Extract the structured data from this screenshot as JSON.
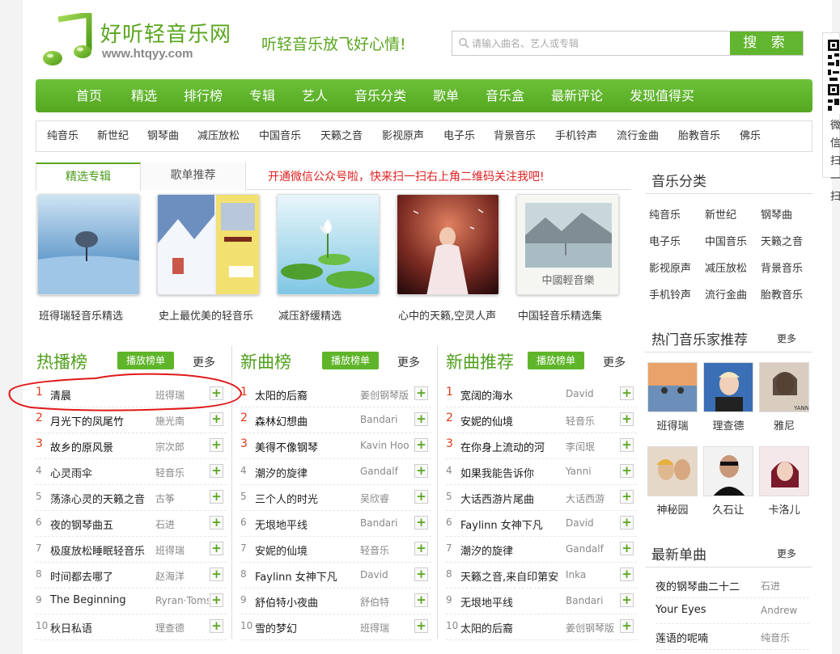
{
  "header": {
    "site_name": "好听轻音乐网",
    "site_url": "www.htqyy.com",
    "slogan": "听轻音乐放飞好心情!",
    "search_placeholder": "请输入曲名、艺人或专辑",
    "search_button": "搜 索",
    "qr_text": "微信扫一扫"
  },
  "nav": [
    "首页",
    "精选",
    "排行榜",
    "专辑",
    "艺人",
    "音乐分类",
    "歌单",
    "音乐盒",
    "最新评论",
    "发现值得买"
  ],
  "categories": [
    "纯音乐",
    "新世纪",
    "钢琴曲",
    "减压放松",
    "中国音乐",
    "天籁之音",
    "影视原声",
    "电子乐",
    "背景音乐",
    "手机铃声",
    "流行金曲",
    "胎教音乐",
    "佛乐"
  ],
  "tabs": {
    "active": "精选专辑",
    "inactive": "歌单推荐"
  },
  "notice": "开通微信公众号啦，快来扫一扫右上角二维码关注我吧!",
  "albums": [
    {
      "title": "班得瑞轻音乐精选",
      "icon": "tree-landscape-cover"
    },
    {
      "title": "史上最优美的轻音乐",
      "icon": "snow-village-cover"
    },
    {
      "title": "减压舒缓精选",
      "icon": "lotus-cover"
    },
    {
      "title": "心中的天籁,空灵人声",
      "icon": "woman-fantasy-cover"
    },
    {
      "title": "中国轻音乐精选集",
      "icon": "chinese-landscape-cover"
    }
  ],
  "cover_text": {
    "chinese": "中國輕音樂"
  },
  "lists": [
    {
      "title": "热播榜",
      "play": "播放榜单",
      "more": "更多",
      "songs": [
        {
          "n": "1",
          "t": "清晨",
          "a": "班得瑞"
        },
        {
          "n": "2",
          "t": "月光下的凤尾竹",
          "a": "施光南"
        },
        {
          "n": "3",
          "t": "故乡的原风景",
          "a": "宗次郎"
        },
        {
          "n": "4",
          "t": "心灵雨伞",
          "a": "轻音乐"
        },
        {
          "n": "5",
          "t": "荡涤心灵的天籁之音",
          "a": "古筝"
        },
        {
          "n": "6",
          "t": "夜的钢琴曲五",
          "a": "石进"
        },
        {
          "n": "7",
          "t": "极度放松睡眠轻音乐",
          "a": "班得瑞"
        },
        {
          "n": "8",
          "t": "时间都去哪了",
          "a": "赵海洋"
        },
        {
          "n": "9",
          "t": "The Beginning",
          "a": "Ryran·Toms"
        },
        {
          "n": "10",
          "t": "秋日私语",
          "a": "理查德"
        }
      ]
    },
    {
      "title": "新曲榜",
      "play": "播放榜单",
      "more": "更多",
      "songs": [
        {
          "n": "1",
          "t": "太阳的后裔",
          "a": "姜创钢琴版"
        },
        {
          "n": "2",
          "t": "森林幻想曲",
          "a": "Bandari"
        },
        {
          "n": "3",
          "t": "美得不像钢琴",
          "a": "Kavin Hoo"
        },
        {
          "n": "4",
          "t": "潮汐的旋律",
          "a": "Gandalf"
        },
        {
          "n": "5",
          "t": "三个人的时光",
          "a": "吴欣睿"
        },
        {
          "n": "6",
          "t": "无垠地平线",
          "a": "Bandari"
        },
        {
          "n": "7",
          "t": "安妮的仙境",
          "a": "轻音乐"
        },
        {
          "n": "8",
          "t": "Faylinn 女神下凡",
          "a": "David"
        },
        {
          "n": "9",
          "t": "舒伯特小夜曲",
          "a": "舒伯特"
        },
        {
          "n": "10",
          "t": "雪的梦幻",
          "a": "班得瑞"
        }
      ]
    },
    {
      "title": "新曲推荐",
      "play": "播放榜单",
      "more": "更多",
      "songs": [
        {
          "n": "1",
          "t": "宽阔的海水",
          "a": "David"
        },
        {
          "n": "2",
          "t": "安妮的仙境",
          "a": "轻音乐"
        },
        {
          "n": "3",
          "t": "在你身上流动的河",
          "a": "李闰珉"
        },
        {
          "n": "4",
          "t": "如果我能告诉你",
          "a": "Yanni"
        },
        {
          "n": "5",
          "t": "大话西游片尾曲",
          "a": "大话西游"
        },
        {
          "n": "6",
          "t": "Faylinn 女神下凡",
          "a": "David"
        },
        {
          "n": "7",
          "t": "潮汐的旋律",
          "a": "Gandalf"
        },
        {
          "n": "8",
          "t": "天籁之音,来自印第安",
          "a": "Inka"
        },
        {
          "n": "9",
          "t": "无垠地平线",
          "a": "Bandari"
        },
        {
          "n": "10",
          "t": "太阳的后裔",
          "a": "姜创钢琴版"
        }
      ]
    }
  ],
  "sidebar": {
    "genres_title": "音乐分类",
    "genres": [
      "纯音乐",
      "新世纪",
      "钢琴曲",
      "电子乐",
      "中国音乐",
      "天籁之音",
      "影视原声",
      "减压放松",
      "背景音乐",
      "手机铃声",
      "流行金曲",
      "胎教音乐"
    ],
    "artists_title": "热门音乐家推荐",
    "artists_more": "更多",
    "artists": [
      "班得瑞",
      "理查德",
      "雅尼",
      "神秘园",
      "久石让",
      "卡洛儿"
    ],
    "yanni_caption": "YANNI",
    "singles_title": "最新单曲",
    "singles_more": "更多",
    "singles": [
      {
        "t": "夜的钢琴曲二十二",
        "a": "石进"
      },
      {
        "t": "Your Eyes",
        "a": "Andrew"
      },
      {
        "t": "莲语的呢喃",
        "a": "纯音乐"
      }
    ]
  },
  "colors": {
    "brand": "#5aa61f",
    "accent_red": "#e02020"
  }
}
